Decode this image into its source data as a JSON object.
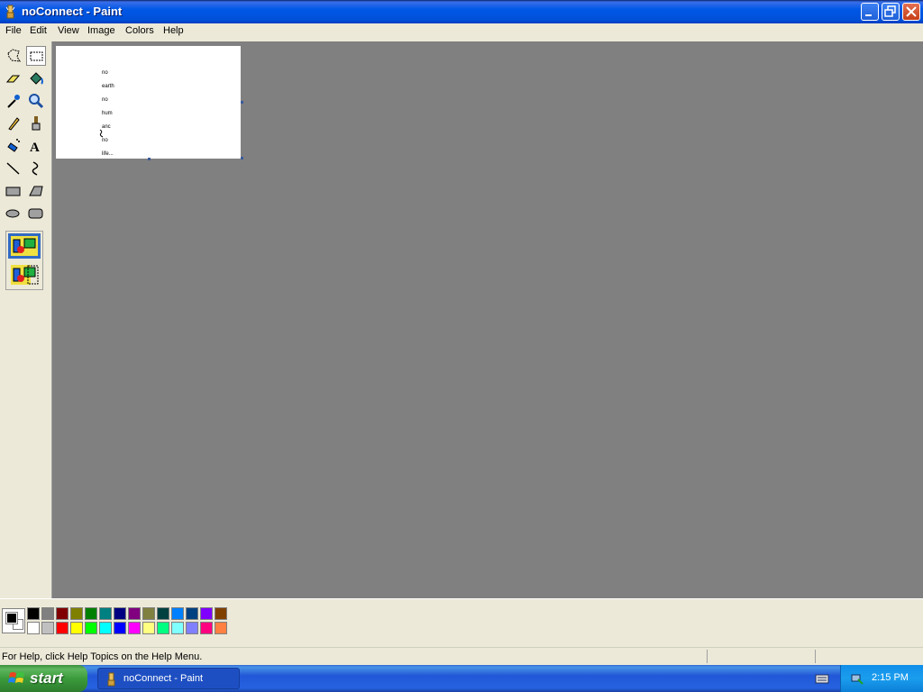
{
  "window": {
    "title": "noConnect - Paint"
  },
  "menu": [
    "File",
    "Edit",
    "View",
    "Image",
    "Colors",
    "Help"
  ],
  "tools": [
    "free-form-select",
    "rectangle-select",
    "eraser",
    "fill-with-color",
    "pick-color",
    "magnifier",
    "pencil",
    "brush",
    "airbrush",
    "text",
    "line",
    "curve",
    "rectangle",
    "polygon",
    "ellipse",
    "rounded-rectangle"
  ],
  "canvas": {
    "words": [
      "no",
      "earth",
      "no",
      "hum",
      "anc",
      "no",
      "life..."
    ]
  },
  "palette": {
    "foreground": "#000000",
    "background": "#FFFFFF",
    "top_row": [
      "#000000",
      "#808080",
      "#800000",
      "#808000",
      "#008000",
      "#008080",
      "#000080",
      "#800080",
      "#808040",
      "#004040",
      "#0080FF",
      "#004080",
      "#8000FF",
      "#804000"
    ],
    "bottom_row": [
      "#FFFFFF",
      "#C0C0C0",
      "#FF0000",
      "#FFFF00",
      "#00FF00",
      "#00FFFF",
      "#0000FF",
      "#FF00FF",
      "#FFFF80",
      "#00FF80",
      "#80FFFF",
      "#8080FF",
      "#FF0080",
      "#FF8040"
    ]
  },
  "status": {
    "text": "For Help, click Help Topics on the Help Menu."
  },
  "taskbar": {
    "start_label": "start",
    "task_label": "noConnect - Paint",
    "clock": "2:15 PM"
  }
}
